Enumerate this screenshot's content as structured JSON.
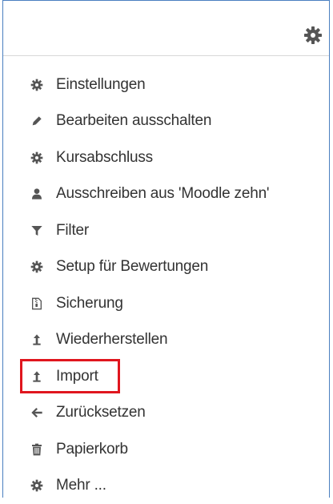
{
  "header": {
    "settings_icon": "gear-icon"
  },
  "menu": {
    "items": [
      {
        "icon": "gear-icon",
        "label": "Einstellungen"
      },
      {
        "icon": "pencil-icon",
        "label": "Bearbeiten ausschalten"
      },
      {
        "icon": "gear-icon",
        "label": "Kursabschluss"
      },
      {
        "icon": "user-icon",
        "label": "Ausschreiben aus 'Moodle zehn'"
      },
      {
        "icon": "filter-icon",
        "label": "Filter"
      },
      {
        "icon": "gear-icon",
        "label": "Setup für Bewertungen"
      },
      {
        "icon": "archive-icon",
        "label": "Sicherung"
      },
      {
        "icon": "upload-arrow-icon",
        "label": "Wiederherstellen"
      },
      {
        "icon": "upload-arrow-icon",
        "label": "Import"
      },
      {
        "icon": "arrow-left-icon",
        "label": "Zurücksetzen"
      },
      {
        "icon": "trash-icon",
        "label": "Papierkorb"
      },
      {
        "icon": "gear-icon",
        "label": "Mehr ..."
      }
    ]
  },
  "highlighted_item": "Import",
  "colors": {
    "border": "#4a7fc0",
    "highlight": "#e0161e",
    "icon": "#555555",
    "text": "#333333"
  }
}
